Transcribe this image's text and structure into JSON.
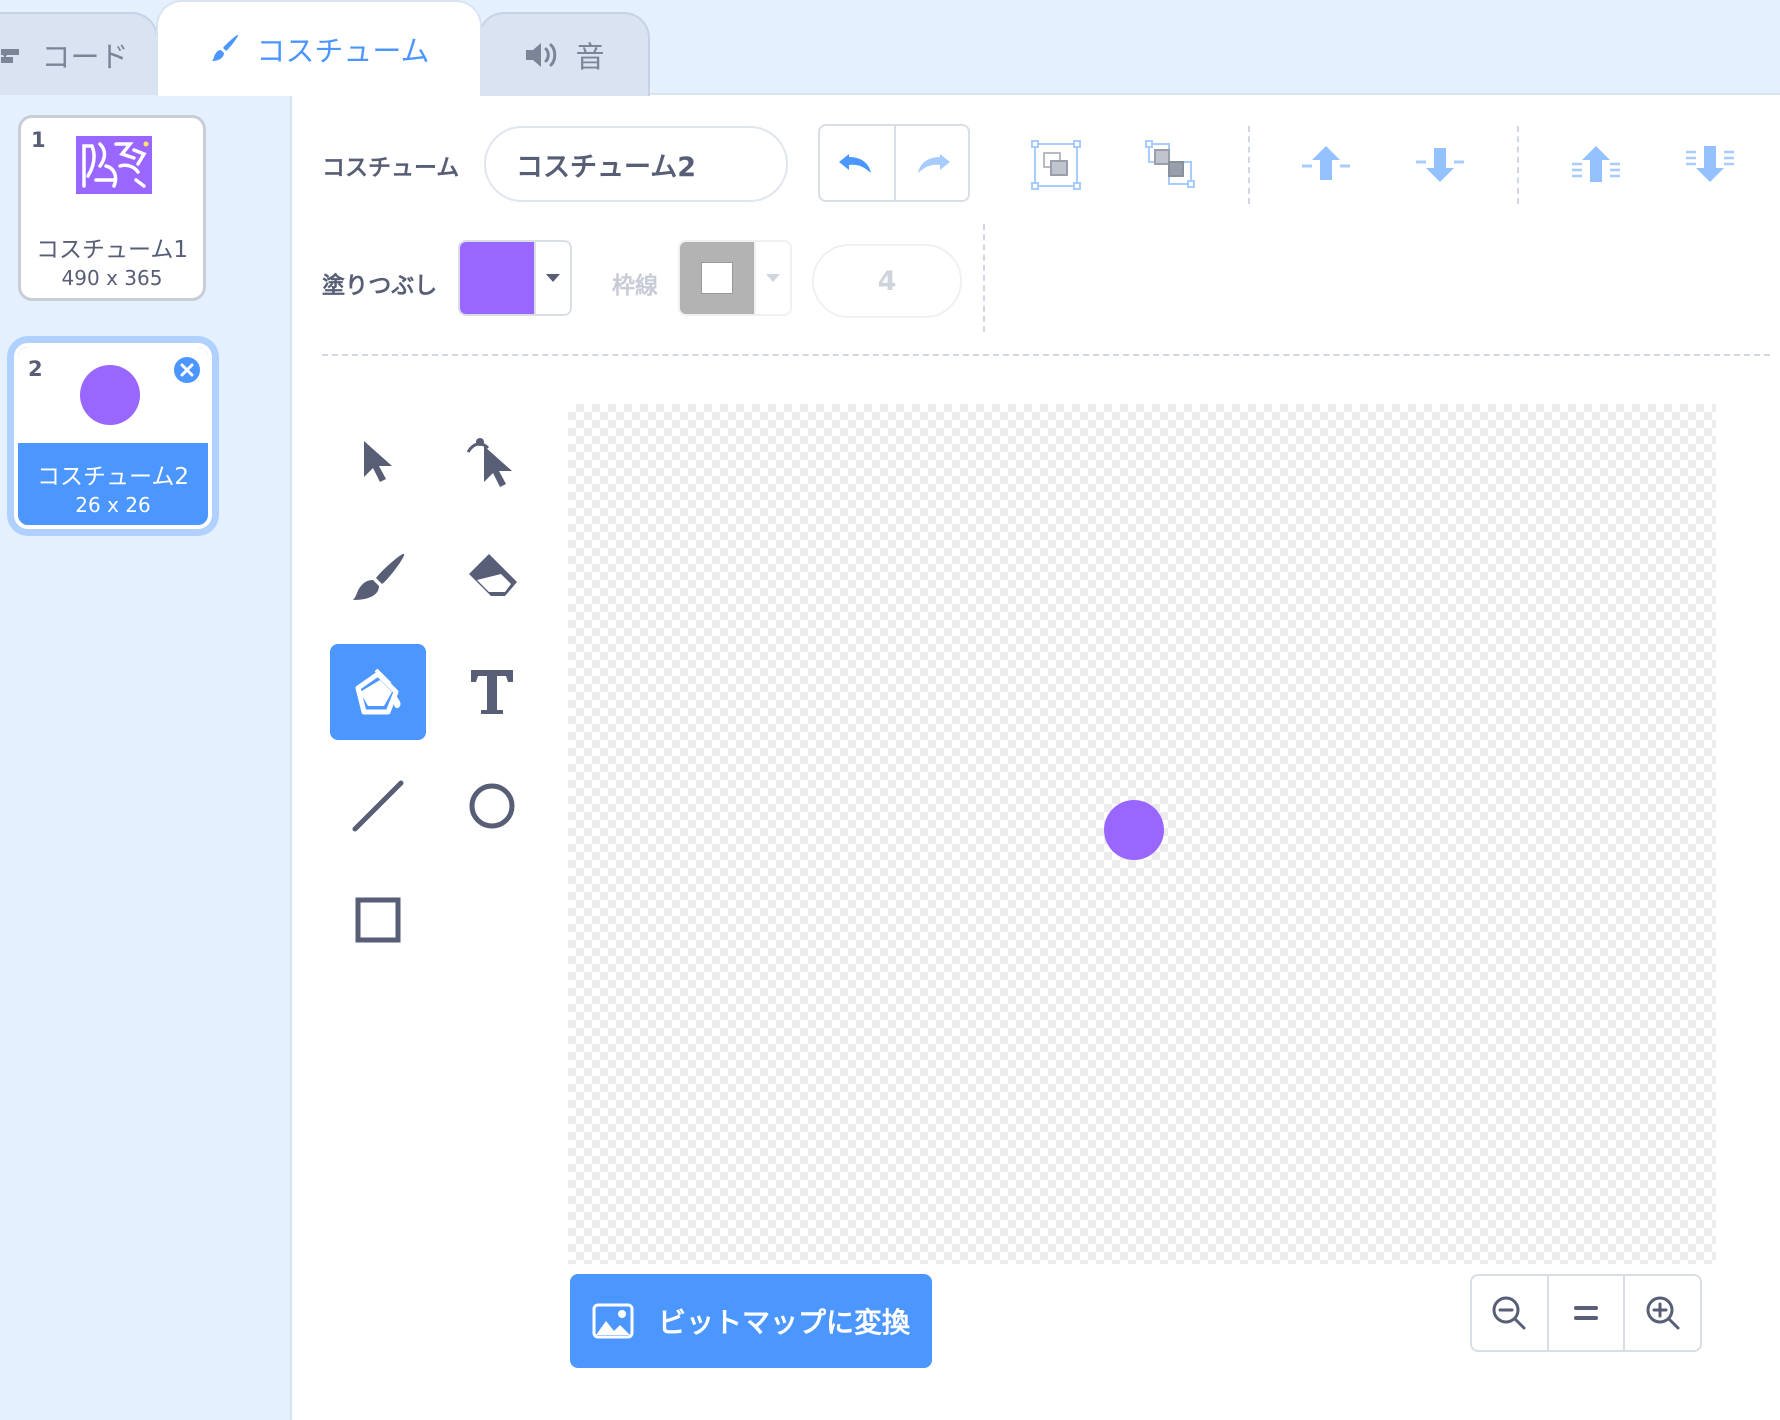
{
  "tabs": {
    "code": "コード",
    "costume": "コスチューム",
    "sound": "音"
  },
  "costumes": [
    {
      "number": "1",
      "name": "コスチューム1",
      "size": "490 x 365"
    },
    {
      "number": "2",
      "name": "コスチューム2",
      "size": "26 x 26"
    }
  ],
  "toolbar": {
    "costume_label": "コスチューム",
    "costume_name": "コスチューム2",
    "fill_label": "塗りつぶし",
    "outline_label": "枠線",
    "stroke_width": "4"
  },
  "canvas": {
    "convert_button": "ビットマップに変換"
  },
  "colors": {
    "accent": "#4c97ff",
    "fill": "#9966ff",
    "outline": "#b3b3b3",
    "tab_bg": "#e5f0ff"
  },
  "icons": {
    "tools": [
      "select-icon",
      "reshape-icon",
      "brush-icon",
      "eraser-icon",
      "fill-icon",
      "text-icon",
      "line-icon",
      "circle-icon",
      "rectangle-icon"
    ],
    "active_tool": "fill-icon"
  }
}
